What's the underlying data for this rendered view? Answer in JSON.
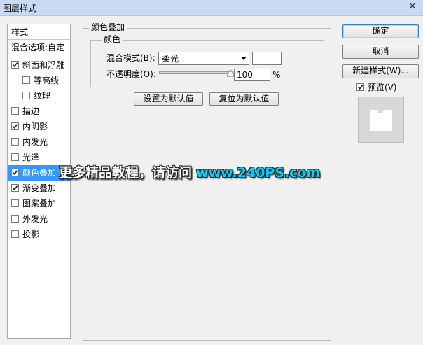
{
  "window": {
    "title": "图层样式",
    "close_glyph": "✕"
  },
  "style_list": {
    "header": "样式",
    "blend_options": "混合选项:自定",
    "items": [
      {
        "label": "斜面和浮雕",
        "checked": true,
        "indent": false
      },
      {
        "label": "等高线",
        "checked": false,
        "indent": true
      },
      {
        "label": "纹理",
        "checked": false,
        "indent": true
      },
      {
        "label": "描边",
        "checked": false,
        "indent": false
      },
      {
        "label": "内阴影",
        "checked": true,
        "indent": false
      },
      {
        "label": "内发光",
        "checked": false,
        "indent": false
      },
      {
        "label": "光泽",
        "checked": false,
        "indent": false
      },
      {
        "label": "颜色叠加",
        "checked": true,
        "indent": false,
        "selected": true
      },
      {
        "label": "渐变叠加",
        "checked": true,
        "indent": false
      },
      {
        "label": "图案叠加",
        "checked": false,
        "indent": false
      },
      {
        "label": "外发光",
        "checked": false,
        "indent": false
      },
      {
        "label": "投影",
        "checked": false,
        "indent": false
      }
    ]
  },
  "panel": {
    "title": "颜色叠加",
    "group_title": "颜色",
    "blend_mode_label": "混合模式(B):",
    "blend_mode_value": "柔光",
    "swatch_color": "#ffffff",
    "opacity_label": "不透明度(O):",
    "opacity_value": "100",
    "opacity_unit": "%",
    "set_default": "设置为默认值",
    "reset_default": "复位为默认值"
  },
  "buttons": {
    "ok": "确定",
    "cancel": "取消",
    "new_style": "新建样式(W)...",
    "preview_label": "预览(V)",
    "preview_checked": true
  },
  "watermark": {
    "text": "更多精品教程，请访问",
    "url": "www.240PS.com"
  },
  "colors": {
    "selection": "#3399ff",
    "titlebar": "#c9daf3",
    "url": "#00d2ff"
  }
}
